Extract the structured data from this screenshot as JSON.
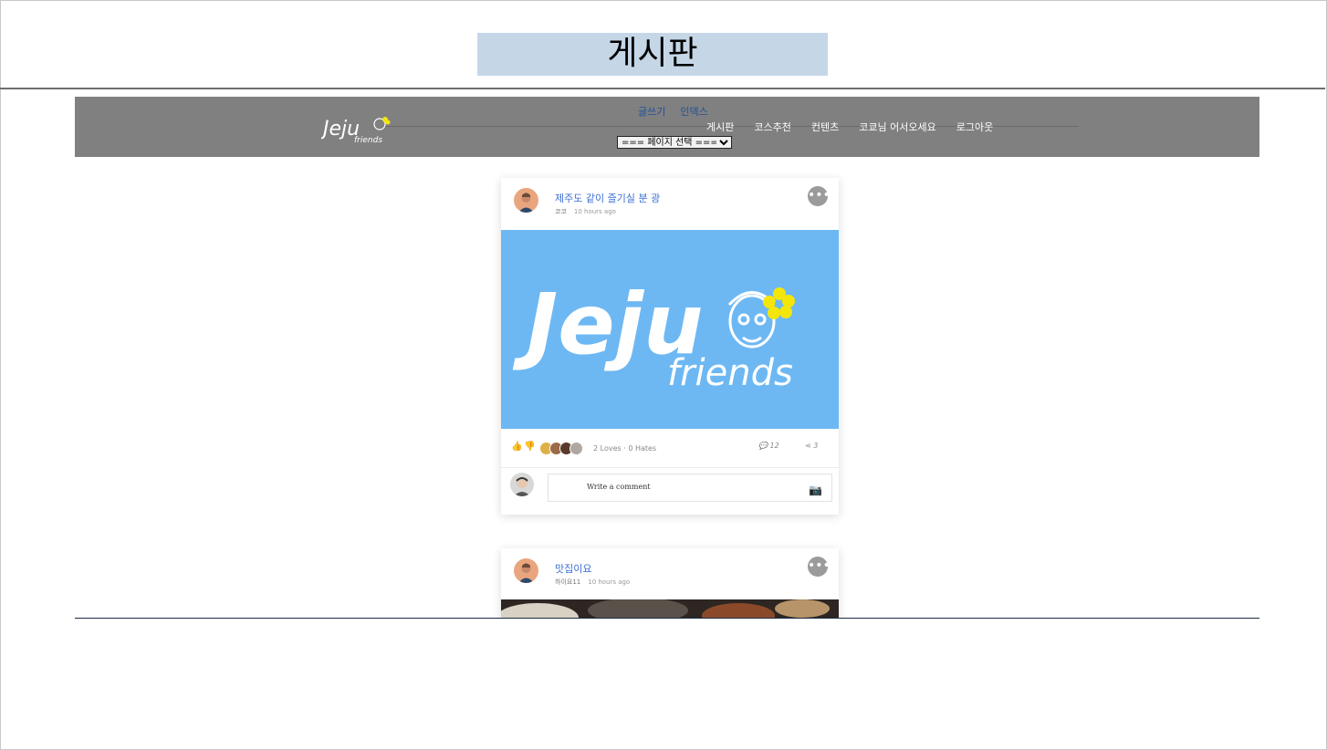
{
  "page": {
    "heading": "게시판"
  },
  "header": {
    "logo": {
      "brand": "Jeju",
      "sub": "friends"
    },
    "sub_links": [
      "글쓰기",
      "인덱스"
    ],
    "page_select": {
      "selected": "=== 페이지 선택 ==="
    },
    "menu": [
      "게시판",
      "코스추천",
      "컨텐츠",
      "코쿄님 어서오세요",
      "로그아웃"
    ]
  },
  "posts": [
    {
      "title": "제주도 같이 즐기실 분 광",
      "author": "코코",
      "time": "10 hours ago",
      "image": {
        "brand": "Jeju",
        "sub": "friends",
        "background": "#6db8f3"
      },
      "loves": "2 Loves",
      "hates": "0 Hates",
      "comments": "12",
      "shares": "3",
      "comment_placeholder": "Write a comment"
    },
    {
      "title": "맛집이요",
      "author": "하이요11",
      "time": "10 hours ago"
    }
  ],
  "icons": {
    "more": "more-options-icon",
    "like": "thumbs-up-icon",
    "dislike": "thumbs-down-icon",
    "comments": "comments-icon",
    "share": "share-icon",
    "camera": "camera-icon"
  },
  "colors": {
    "heading_bg": "#c5d7e7",
    "navbar_bg": "#808080",
    "link": "#3b6fd6",
    "sub_link": "#1f4f9a",
    "flower": "#f5e60a"
  }
}
